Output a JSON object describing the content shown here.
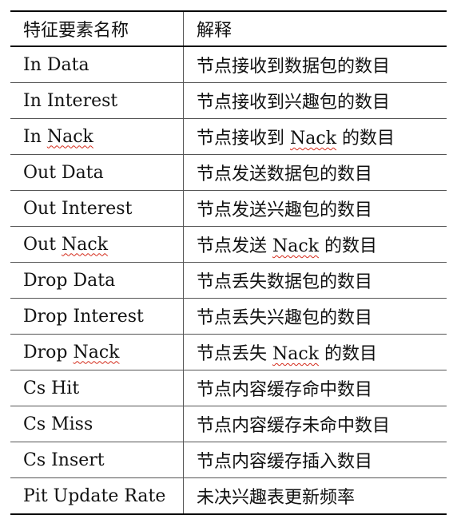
{
  "table": {
    "headers": [
      "特征要素名称",
      "解释"
    ],
    "rows": [
      {
        "name_parts": [
          "In Data"
        ],
        "desc_parts": [
          "节点接收到数据包的数目"
        ]
      },
      {
        "name_parts": [
          "In Interest"
        ],
        "desc_parts": [
          "节点接收到兴趣包的数目"
        ]
      },
      {
        "name_parts": [
          "In ",
          "Nack"
        ],
        "desc_parts": [
          "节点接收到 ",
          "Nack",
          " 的数目"
        ]
      },
      {
        "name_parts": [
          "Out Data"
        ],
        "desc_parts": [
          "节点发送数据包的数目"
        ]
      },
      {
        "name_parts": [
          "Out Interest"
        ],
        "desc_parts": [
          "节点发送兴趣包的数目"
        ]
      },
      {
        "name_parts": [
          "Out ",
          "Nack"
        ],
        "desc_parts": [
          "节点发送 ",
          "Nack",
          " 的数目"
        ]
      },
      {
        "name_parts": [
          "Drop Data"
        ],
        "desc_parts": [
          "节点丢失数据包的数目"
        ]
      },
      {
        "name_parts": [
          "Drop Interest"
        ],
        "desc_parts": [
          "节点丢失兴趣包的数目"
        ]
      },
      {
        "name_parts": [
          "Drop ",
          "Nack"
        ],
        "desc_parts": [
          "节点丢失 ",
          "Nack",
          " 的数目"
        ]
      },
      {
        "name_parts": [
          "Cs Hit"
        ],
        "desc_parts": [
          "节点内容缓存命中数目"
        ]
      },
      {
        "name_parts": [
          "Cs Miss"
        ],
        "desc_parts": [
          "节点内容缓存未命中数目"
        ]
      },
      {
        "name_parts": [
          "Cs Insert"
        ],
        "desc_parts": [
          "节点内容缓存插入数目"
        ]
      },
      {
        "name_parts": [
          "Pit Update Rate"
        ],
        "desc_parts": [
          "未决兴趣表更新频率"
        ]
      }
    ]
  }
}
